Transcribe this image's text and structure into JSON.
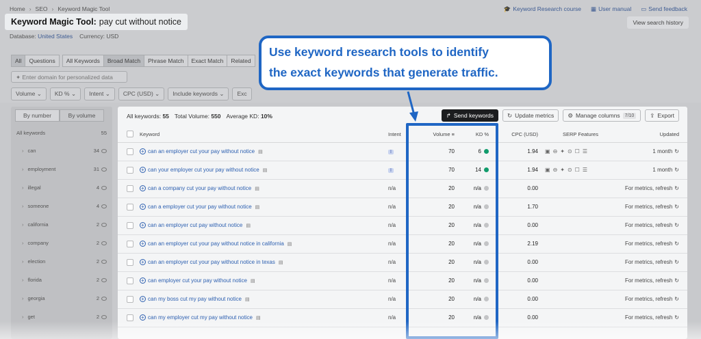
{
  "breadcrumb": [
    "Home",
    "SEO",
    "Keyword Magic Tool"
  ],
  "top_links": {
    "course": "Keyword Research course",
    "manual": "User manual",
    "feedback": "Send feedback"
  },
  "title": {
    "label": "Keyword Magic Tool:",
    "query": "pay cut without notice"
  },
  "database": {
    "label": "Database:",
    "value": "United States",
    "currency": "Currency: USD"
  },
  "view_history": "View search history",
  "match_tabs": [
    "All",
    "Questions",
    "All Keywords",
    "Broad Match",
    "Phrase Match",
    "Exact Match",
    "Related"
  ],
  "domain_placeholder": "Enter domain for personalized data",
  "filters": [
    "Volume",
    "KD %",
    "Intent",
    "CPC (USD)",
    "Include keywords",
    "Exc"
  ],
  "sidebar": {
    "by_number": "By number",
    "by_volume": "By volume",
    "header_label": "All keywords",
    "header_count": "55",
    "items": [
      {
        "label": "can",
        "count": "34"
      },
      {
        "label": "employment",
        "count": "31"
      },
      {
        "label": "illegal",
        "count": "4"
      },
      {
        "label": "someone",
        "count": "4"
      },
      {
        "label": "california",
        "count": "2"
      },
      {
        "label": "company",
        "count": "2"
      },
      {
        "label": "election",
        "count": "2"
      },
      {
        "label": "florida",
        "count": "2"
      },
      {
        "label": "georgia",
        "count": "2"
      },
      {
        "label": "get",
        "count": "2"
      }
    ]
  },
  "stats": {
    "all_label": "All keywords:",
    "all_value": "55",
    "volume_label": "Total Volume:",
    "volume_value": "550",
    "kd_label": "Average KD:",
    "kd_value": "10%"
  },
  "actions": {
    "send": "Send keywords",
    "update": "Update metrics",
    "manage": "Manage columns",
    "manage_badge": "7/10",
    "export": "Export"
  },
  "columns": {
    "keyword": "Keyword",
    "intent": "Intent",
    "volume": "Volume",
    "kd": "KD %",
    "cpc": "CPC (USD)",
    "serp": "SERP Features",
    "updated": "Updated"
  },
  "rows": [
    {
      "keyword": "can an employer cut your pay without notice",
      "intent": "I",
      "volume": "70",
      "kd": "6",
      "kd_color": "green",
      "cpc": "1.94",
      "serp": true,
      "updated": "1 month"
    },
    {
      "keyword": "can your employer cut your pay without notice",
      "intent": "I",
      "volume": "70",
      "kd": "14",
      "kd_color": "green",
      "cpc": "1.94",
      "serp": true,
      "updated": "1 month"
    },
    {
      "keyword": "can a company cut your pay without notice",
      "intent": "n/a",
      "volume": "20",
      "kd": "n/a",
      "kd_color": "gray",
      "cpc": "0.00",
      "serp": false,
      "updated": "For metrics, refresh"
    },
    {
      "keyword": "can a employer cut your pay without notice",
      "intent": "n/a",
      "volume": "20",
      "kd": "n/a",
      "kd_color": "gray",
      "cpc": "1.70",
      "serp": false,
      "updated": "For metrics, refresh"
    },
    {
      "keyword": "can an employer cut pay without notice",
      "intent": "n/a",
      "volume": "20",
      "kd": "n/a",
      "kd_color": "gray",
      "cpc": "0.00",
      "serp": false,
      "updated": "For metrics, refresh"
    },
    {
      "keyword": "can an employer cut your pay without notice in california",
      "intent": "n/a",
      "volume": "20",
      "kd": "n/a",
      "kd_color": "gray",
      "cpc": "2.19",
      "serp": false,
      "updated": "For metrics, refresh"
    },
    {
      "keyword": "can an employer cut your pay without notice in texas",
      "intent": "n/a",
      "volume": "20",
      "kd": "n/a",
      "kd_color": "gray",
      "cpc": "0.00",
      "serp": false,
      "updated": "For metrics, refresh"
    },
    {
      "keyword": "can employer cut your pay without notice",
      "intent": "n/a",
      "volume": "20",
      "kd": "n/a",
      "kd_color": "gray",
      "cpc": "0.00",
      "serp": false,
      "updated": "For metrics, refresh"
    },
    {
      "keyword": "can my boss cut my pay without notice",
      "intent": "n/a",
      "volume": "20",
      "kd": "n/a",
      "kd_color": "gray",
      "cpc": "0.00",
      "serp": false,
      "updated": "For metrics, refresh"
    },
    {
      "keyword": "can my employer cut my pay without notice",
      "intent": "n/a",
      "volume": "20",
      "kd": "n/a",
      "kd_color": "gray",
      "cpc": "0.00",
      "serp": false,
      "updated": "For metrics, refresh"
    }
  ],
  "callout": {
    "line1": "Use keyword research tools to identify",
    "line2": "the exact keywords that generate traffic."
  },
  "colors": {
    "accent": "#1f66c4",
    "kd_green": "#119c6c",
    "link": "#2c5fb0"
  }
}
